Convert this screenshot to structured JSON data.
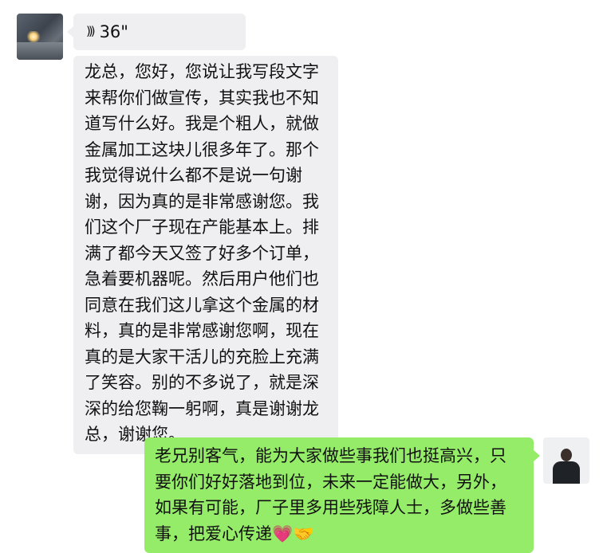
{
  "messages": {
    "voice": {
      "icon": "voice-wave-icon",
      "duration": "36\""
    },
    "incoming_text": {
      "lines": [
        "龙总，您好，您说让我写段文字",
        "来帮你们做宣传，其实我也不知",
        "道写什么好。我是个粗人，就做",
        "金属加工这块儿很多年了。那个",
        "我觉得说什么都不是说一句谢",
        "谢，因为真的是非常感谢您。我",
        "们这个厂子现在产能基本上。排",
        "满了都今天又签了好多个订单，",
        "急着要机器呢。然后用户他们也",
        "同意在我们这儿拿这个金属的材",
        "料，真的是非常感谢您啊，现在",
        "真的是大家干活儿的充脸上充满",
        "了笑容。别的不多说了，就是深",
        "深的给您鞠一躬啊，真是谢谢龙",
        "总，谢谢您。"
      ]
    },
    "reply_text": {
      "lines": [
        "老兄别客气，能为大家做些事我们也挺高兴，只",
        "要你们好好落地到位，未来一定能做大，另外，",
        "如果有可能，厂子里多用些残障人士，多做些善",
        "事，把爱心传递💗🤝"
      ]
    }
  },
  "colors": {
    "incoming_bubble": "#efeff1",
    "outgoing_bubble": "#95ec69",
    "background": "#ffffff"
  }
}
